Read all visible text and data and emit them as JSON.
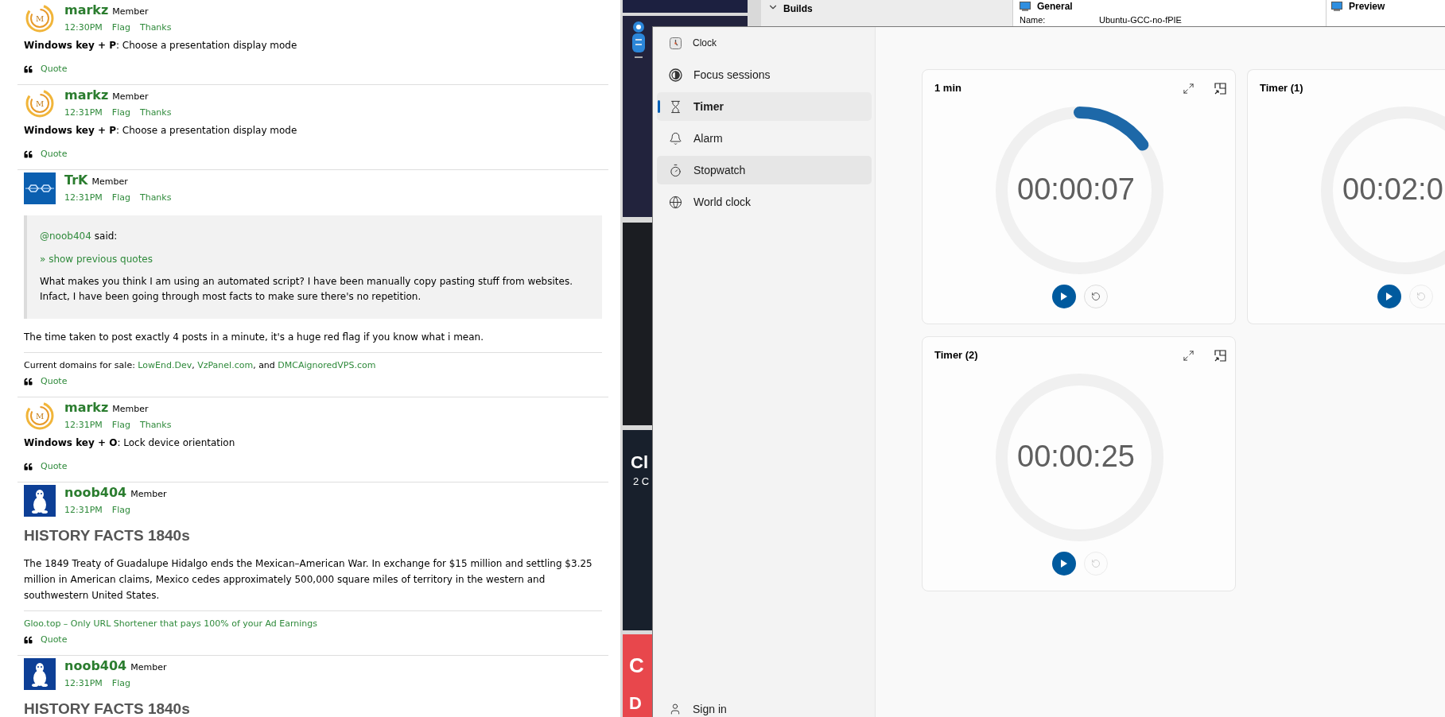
{
  "forum": {
    "posts": [
      {
        "avatar": {
          "kind": "spiral",
          "text": "M"
        },
        "author": "markz",
        "role": "Member",
        "time": "12:30PM",
        "actions": [
          "Flag",
          "Thanks"
        ],
        "blocks": [
          {
            "kind": "text",
            "text": "**Windows key + P**: Choose a presentation display mode"
          }
        ],
        "quote_label": "Quote"
      },
      {
        "avatar": {
          "kind": "spiral",
          "text": "M"
        },
        "author": "markz",
        "role": "Member",
        "time": "12:31PM",
        "actions": [
          "Flag",
          "Thanks"
        ],
        "blocks": [
          {
            "kind": "text",
            "text": "**Windows key + P**: Choose a presentation display mode"
          }
        ],
        "quote_label": "Quote"
      },
      {
        "avatar": {
          "kind": "glasses"
        },
        "author": "TrK",
        "role": "Member",
        "time": "12:31PM",
        "actions": [
          "Flag",
          "Thanks"
        ],
        "blocks": [
          {
            "kind": "quote",
            "mention": "@noob404",
            "said": "said:",
            "toggle": "» show previous quotes",
            "text": "What makes you think I am using an automated script? I have been manually copy pasting stuff from websites. Infact, I have been going through most facts to make sure there's no repetition."
          },
          {
            "kind": "text",
            "text": "The time taken to post exactly 4 posts in a minute, it's a huge red flag if you know what i mean."
          }
        ],
        "signature": [
          {
            "text": "Current domains for sale: ",
            "link": false
          },
          {
            "text": "LowEnd.Dev",
            "link": true
          },
          {
            "text": ", ",
            "link": false
          },
          {
            "text": "VzPanel.com",
            "link": true
          },
          {
            "text": ", and ",
            "link": false
          },
          {
            "text": "DMCAignoredVPS.com",
            "link": true
          }
        ],
        "quote_label": "Quote"
      },
      {
        "avatar": {
          "kind": "spiral",
          "text": "M"
        },
        "author": "markz",
        "role": "Member",
        "time": "12:31PM",
        "actions": [
          "Flag",
          "Thanks"
        ],
        "blocks": [
          {
            "kind": "text",
            "text": "**Windows key + O**: Lock device orientation"
          }
        ],
        "quote_label": "Quote"
      },
      {
        "avatar": {
          "kind": "penguin"
        },
        "author": "noob404",
        "role": "Member",
        "time": "12:31PM",
        "actions": [
          "Flag"
        ],
        "blocks": [
          {
            "kind": "heading",
            "text": "HISTORY FACTS 1840s"
          },
          {
            "kind": "text",
            "text": "The 1849 Treaty of Guadalupe Hidalgo ends the Mexican–American War. In exchange for $15 million and settling $3.25 million in American claims, Mexico cedes approximately 500,000 square miles of territory in the western and southwestern United States."
          }
        ],
        "signature": [
          {
            "text": "Gloo.top – Only URL Shortener that pays 100% of your Ad Earnings",
            "link": true
          }
        ],
        "quote_label": "Quote"
      },
      {
        "avatar": {
          "kind": "penguin"
        },
        "author": "noob404",
        "role": "Member",
        "time": "12:31PM",
        "actions": [
          "Flag"
        ],
        "blocks": [
          {
            "kind": "heading",
            "text": "HISTORY FACTS 1840s"
          }
        ]
      }
    ]
  },
  "background_page": {
    "tiles": [
      {
        "kind": "banner"
      },
      {
        "kind": "robot"
      },
      {
        "kind": "photo"
      },
      {
        "kind": "promo",
        "lines": [
          "Cl",
          "2 C"
        ]
      },
      {
        "kind": "promo_red",
        "lines": [
          "C",
          "D"
        ]
      }
    ]
  },
  "top_windows": {
    "builds_header": "Builds",
    "general": {
      "title": "General",
      "fields": [
        {
          "label": "Name:",
          "value": "Ubuntu-GCC-no-fPIE"
        }
      ]
    },
    "preview": {
      "title": "Preview"
    }
  },
  "clock": {
    "app_title": "Clock",
    "nav": [
      {
        "kind": "focus",
        "label": "Focus sessions",
        "selected": false,
        "hovered": false
      },
      {
        "kind": "timer",
        "label": "Timer",
        "selected": true,
        "hovered": false
      },
      {
        "kind": "alarm",
        "label": "Alarm",
        "selected": false,
        "hovered": false
      },
      {
        "kind": "stopwatch",
        "label": "Stopwatch",
        "selected": false,
        "hovered": true
      },
      {
        "kind": "world",
        "label": "World clock",
        "selected": false,
        "hovered": false
      }
    ],
    "sign_in": "Sign in",
    "timers": [
      {
        "kind": "full",
        "title": "1 min",
        "time": "00:00:07",
        "level": 0.15,
        "reset_enabled": true
      },
      {
        "kind": "cut",
        "title": "Timer (1)",
        "time": "00:02:0",
        "level": 0,
        "reset_enabled": false
      },
      {
        "kind": "full",
        "title": "Timer (2)",
        "time": "00:00:25",
        "level": 0,
        "reset_enabled": false
      }
    ]
  }
}
